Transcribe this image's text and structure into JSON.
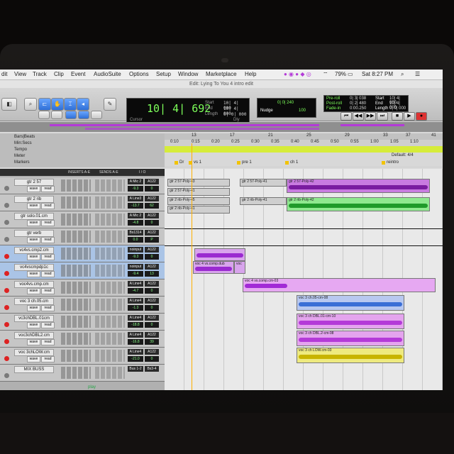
{
  "menu": {
    "items": [
      "dit",
      "View",
      "Track",
      "Clip",
      "Event",
      "AudioSuite",
      "Options",
      "Setup",
      "Window",
      "Marketplace",
      "Help"
    ],
    "battery": "79%",
    "clock": "Sat 8:27 PM"
  },
  "window": {
    "title": "Edit: Lying To You 4 intro edit"
  },
  "counter": {
    "main": "10| 4| 692",
    "cursor_label": "Cursor",
    "start_label": "Start",
    "start": "10| 4| 000",
    "end_label": "End",
    "end": "10| 4| 000",
    "length_label": "Length",
    "length": "0| 0| 000",
    "dly_label": "Dly"
  },
  "grid": {
    "grid_value": "0| 0| 240",
    "nudge_label": "Nudge",
    "nudge_value": "100"
  },
  "transport": {
    "preroll_label": "Pre-roll",
    "preroll": "0| 3| 038",
    "postroll_label": "Post-roll",
    "postroll": "0| 2| 480",
    "fadein_label": "Fade-in",
    "fadein": "0:00.250",
    "start_label": "Start",
    "start": "10| 4| 000",
    "end_label": "End",
    "end": "10| 4| 000",
    "length_label": "Length",
    "length": "0| 0| 000"
  },
  "ruler": {
    "rows": [
      "Bars|Beats",
      "Min:Secs",
      "Tempo",
      "Meter",
      "Markers"
    ],
    "bar_ticks": [
      "13",
      "17",
      "21",
      "25",
      "29",
      "33",
      "37",
      "41"
    ],
    "sec_ticks": [
      "0:10",
      "0:15",
      "0:20",
      "0:25",
      "0:30",
      "0:35",
      "0:40",
      "0:45",
      "0:50",
      "0:55",
      "1:00",
      "1:05",
      "1:10"
    ],
    "meter_label": "Default: 4/4",
    "markers": [
      "Dr",
      "vs 1",
      "pre 1",
      "ch 1",
      "reintro"
    ]
  },
  "columns": {
    "inserts": "INSERTS A-E",
    "sends": "SENDS A-E",
    "io": "I / O"
  },
  "tracks": [
    {
      "name": "gtr 2 57",
      "io1": "A Mic 2",
      "io2": "A122",
      "vol": "-9.3",
      "pan": "0"
    },
    {
      "name": "gtr 2 rib",
      "io1": "A Line3",
      "io2": "A122",
      "vol": "-13.7",
      "pan": "62"
    },
    {
      "name": "gtr solo.01.cm",
      "io1": "A Mic 2",
      "io2": "A122",
      "vol": "-4.8",
      "pan": "0"
    },
    {
      "name": "gtr verb",
      "io1": "Bs1314",
      "io2": "A122",
      "vol": "0.0",
      "pan": "P"
    },
    {
      "name": "vc4vs.cmp2.cm",
      "io1": "noinput",
      "io2": "A122",
      "vol": "-9.3",
      "pan": "0"
    },
    {
      "name": "vc4vscmpdp1c",
      "io1": "noinput",
      "io2": "A122",
      "vol": "-9.4",
      "pan": "13"
    },
    {
      "name": "voc4vs.cmp.cm",
      "io1": "A Line4",
      "io2": "A122",
      "vol": "-4.7",
      "pan": "0"
    },
    {
      "name": "voc 3 ch.05.cm",
      "io1": "A Line4",
      "io2": "A122",
      "vol": "-1.3",
      "pan": "0"
    },
    {
      "name": "vc3chDBL.01cm",
      "io1": "A Line4",
      "io2": "A122",
      "vol": "-18.8",
      "pan": "0"
    },
    {
      "name": "voc3chDBL2.cm",
      "io1": "A Line4",
      "io2": "A122",
      "vol": "-16.8",
      "pan": "39"
    },
    {
      "name": "voc 3chLOW.cm",
      "io1": "A Line4",
      "io2": "A122",
      "vol": "-21.0",
      "pan": "0"
    },
    {
      "name": "MIX BUSS",
      "io1": "Bus 1-2",
      "io2": "Bs3-4",
      "vol": "",
      "pan": ""
    }
  ],
  "clips": {
    "gtr57a": "gtr 2 57-Poly-43",
    "gtr57b": "gtr 2 57-Poly-41",
    "gtr57c": "gtr 2 57-Poly-42",
    "ribA": "gtr 2 rib-Poly-45",
    "ribB": "gtr 2 rib-Poly-41",
    "ribC": "gtr 2 rib-Poly-42",
    "vc4a": "voc 4 vs.comp.dub",
    "vc4b": "voc",
    "vc4c": "voc 4 vs.comp.cm-03",
    "ch05": "voc 3 ch.05-cm-08",
    "dbl01": "voc 3 ch DBL.01-cm-10",
    "dbl2": "voc 3 ch DBL.2-cm-08",
    "low": "voc 3 ch LOW.cm-03"
  },
  "bottom": {
    "play": "play"
  },
  "colors": {
    "green": "#2aa64a",
    "purple": "#b43ad8",
    "blue": "#3a6fd6",
    "yellow": "#d6cc22",
    "cursor": "#ffb000"
  }
}
